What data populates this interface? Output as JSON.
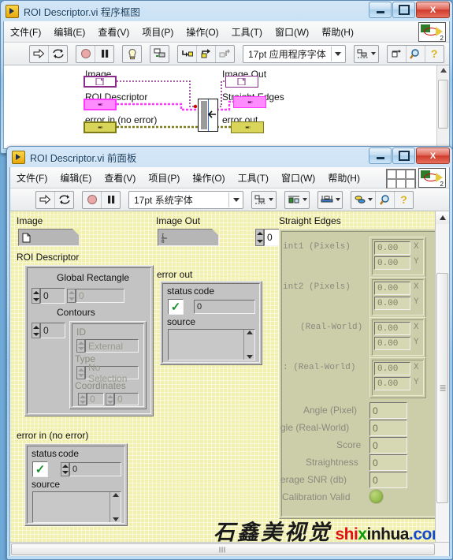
{
  "block_diagram_window": {
    "title": "ROI Descriptor.vi 程序框图",
    "icon_name": "labview-vi-icon",
    "window_buttons": {
      "minimize": "–",
      "maximize": "□",
      "close": "X"
    },
    "menu": [
      "文件(F)",
      "编辑(E)",
      "查看(V)",
      "项目(P)",
      "操作(O)",
      "工具(T)",
      "窗口(W)",
      "帮助(H)"
    ],
    "toolbar": {
      "run": "run-arrow-icon",
      "run_continuously": "run-continuously-icon",
      "abort": "abort-execution-icon",
      "pause": "pause-icon",
      "highlight": "highlight-execution-bulb-icon",
      "retain_values": "retain-wire-values-icon",
      "step_into": "step-into-icon",
      "step_over": "step-over-icon",
      "step_out": "step-out-icon",
      "font": "17pt 应用程序字体",
      "align": "align-objects-icon",
      "distribute": "reorder-icon",
      "search": "search-icon",
      "help": "context-help-icon"
    },
    "diagram": {
      "labels": {
        "image": "Image",
        "roi_descriptor": "ROI Descriptor",
        "error_in": "error in (no error)",
        "image_out": "Image Out",
        "straight_edges": "Straight Edges",
        "error_out": "error out"
      },
      "terminals": [
        {
          "name": "image-terminal",
          "kind": "control",
          "color": "#8a2d8a"
        },
        {
          "name": "roi-descriptor-terminal",
          "kind": "control",
          "color": "#ff39ff"
        },
        {
          "name": "error-in-terminal",
          "kind": "control",
          "color": "#7d7a18"
        },
        {
          "name": "image-out-terminal",
          "kind": "indicator",
          "color": "#8a2d8a"
        },
        {
          "name": "straight-edges-terminal",
          "kind": "indicator",
          "color": "#ff39ff"
        },
        {
          "name": "error-out-terminal",
          "kind": "indicator",
          "color": "#7d7a18"
        }
      ],
      "subvi_node": "subvi-node"
    }
  },
  "front_panel_window": {
    "title": "ROI Descriptor.vi 前面板",
    "icon_name": "labview-vi-icon",
    "window_buttons": {
      "minimize": "–",
      "maximize": "□",
      "close": "X"
    },
    "menu": [
      "文件(F)",
      "编辑(E)",
      "查看(V)",
      "项目(P)",
      "操作(O)",
      "工具(T)",
      "窗口(W)",
      "帮助(H)"
    ],
    "toolbar": {
      "run": "run-arrow-icon",
      "run_continuously": "run-continuously-icon",
      "abort": "abort-execution-icon",
      "pause": "pause-icon",
      "font": "17pt 系统字体",
      "align": "align-objects-icon",
      "distribute": "distribute-objects-icon",
      "resize": "resize-objects-icon",
      "reorder": "reorder-icon",
      "search": "search-icon",
      "help": "context-help-icon"
    },
    "panel": {
      "image": {
        "label": "Image",
        "control_name": "image-control",
        "glyph": "page-icon"
      },
      "roi_descriptor": {
        "label": "ROI Descriptor",
        "global_rectangle": {
          "label": "Global Rectangle",
          "index_value": "0",
          "element_value": "0"
        },
        "contours": {
          "label": "Contours",
          "index_value": "0",
          "id_label": "ID",
          "id_value": "External",
          "type_label": "Type",
          "type_value": "No Selection",
          "coordinates_label": "Coordinates",
          "coord_index": "0",
          "coord_value": "0"
        }
      },
      "error_in": {
        "label": "error in (no error)",
        "status_label": "status",
        "code_label": "code",
        "code_value": "0",
        "source_label": "source",
        "source_value": ""
      },
      "image_out": {
        "label": "Image Out",
        "glyph": "image-out-icon"
      },
      "error_out": {
        "label": "error out",
        "status_label": "status",
        "code_label": "code",
        "code_value": "0",
        "source_label": "source",
        "source_value": ""
      },
      "array_index": {
        "value": "0"
      },
      "straight_edges": {
        "label": "Straight Edges",
        "rows": [
          {
            "label": "int1 (Pixels)",
            "x": "0.00",
            "y": "0.00",
            "x_tag": "X",
            "y_tag": "Y"
          },
          {
            "label": "int2 (Pixels)",
            "x": "0.00",
            "y": "0.00",
            "x_tag": "X",
            "y_tag": "Y"
          },
          {
            "label": "(Real-World)",
            "x": "0.00",
            "y": "0.00",
            "x_tag": "X",
            "y_tag": "Y"
          },
          {
            "label": ": (Real-World)",
            "x": "0.00",
            "y": "0.00",
            "x_tag": "X",
            "y_tag": "Y"
          }
        ],
        "scalars": [
          {
            "label": "Angle (Pixel)",
            "value": "0"
          },
          {
            "label": "gle (Real-World)",
            "value": "0"
          },
          {
            "label": "Score",
            "value": "0"
          },
          {
            "label": "Straightness",
            "value": "0"
          },
          {
            "label": "erage SNR (db)",
            "value": "0"
          }
        ],
        "calibration_valid": {
          "label": "Calibration Valid",
          "state": "on"
        }
      }
    },
    "watermark": {
      "cn": "石鑫美视觉",
      "en_parts": [
        "shi",
        "x",
        "inhua",
        ".com"
      ]
    }
  }
}
